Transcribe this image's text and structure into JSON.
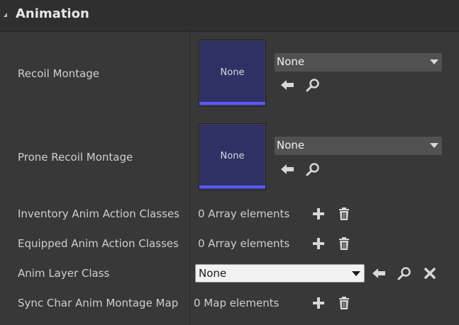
{
  "section": {
    "title": "Animation"
  },
  "rows": {
    "recoil_montage": {
      "label": "Recoil Montage",
      "thumb": "None",
      "value": "None"
    },
    "prone_recoil_montage": {
      "label": "Prone Recoil Montage",
      "thumb": "None",
      "value": "None"
    },
    "inventory_anim_action_classes": {
      "label": "Inventory Anim Action Classes",
      "value": "0 Array elements"
    },
    "equipped_anim_action_classes": {
      "label": "Equipped Anim Action Classes",
      "value": "0 Array elements"
    },
    "anim_layer_class": {
      "label": "Anim Layer Class",
      "value": "None"
    },
    "sync_char_anim_montage_map": {
      "label": "Sync Char Anim Montage Map",
      "value": "0 Map elements"
    }
  },
  "icons": {
    "use_selected": "left-arrow-icon",
    "browse": "magnifier-icon",
    "add": "plus-icon",
    "remove_all": "trash-icon",
    "clear": "close-icon",
    "collapse": "triangle-collapse-icon"
  },
  "colors": {
    "background": "#383838",
    "header": "#2f2f2f",
    "thumbnail": "#2f3064",
    "thumbnail_bar": "#5b5bff"
  }
}
